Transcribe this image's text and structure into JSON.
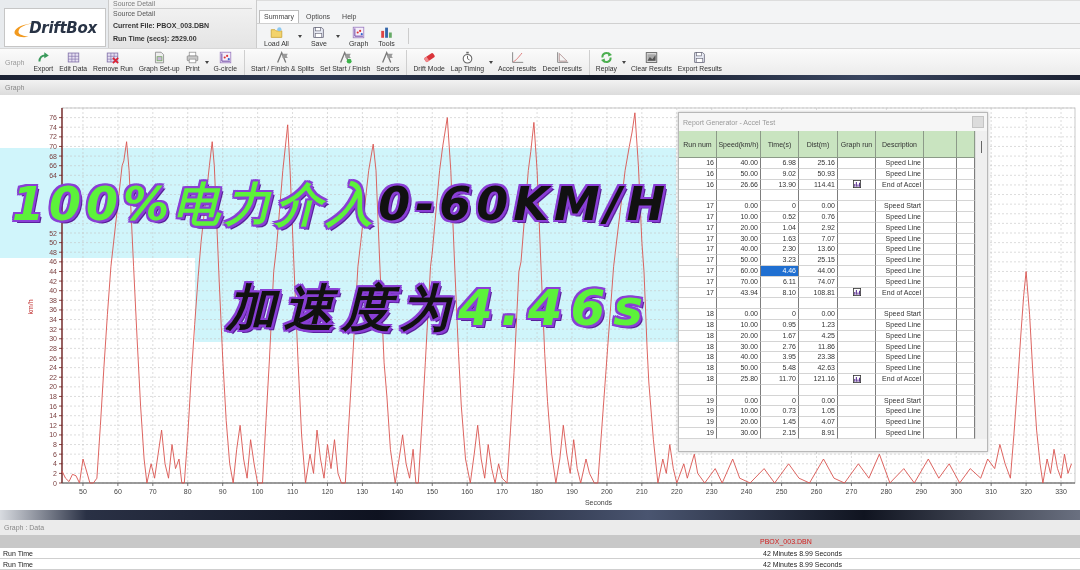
{
  "logo": "DriftBox",
  "source_panel": {
    "header": "Source Detail",
    "title": "Source Detail",
    "current_file": "Current File: PBOX_003.DBN",
    "run_time": "Run Time (secs): 2529.00"
  },
  "menu_tabs": [
    {
      "label": "Summary",
      "selected": true
    },
    {
      "label": "Options",
      "selected": false
    },
    {
      "label": "Help",
      "selected": false
    }
  ],
  "ribbon_buttons": [
    {
      "label": "Load All",
      "dropdown": true
    },
    {
      "label": "Save",
      "dropdown": true
    },
    {
      "label": "Graph",
      "dropdown": false
    },
    {
      "label": "Tools",
      "dropdown": false
    }
  ],
  "toolbar": {
    "label": "Graph",
    "groups": [
      {
        "items": [
          {
            "label": "Export",
            "dropdown": false
          },
          {
            "label": "Edit Data",
            "dropdown": false
          },
          {
            "label": "Remove Run",
            "dropdown": false
          },
          {
            "label": "Graph Set-up",
            "dropdown": false
          },
          {
            "label": "Print",
            "dropdown": true
          },
          {
            "label": "G-circle",
            "dropdown": false
          }
        ]
      },
      {
        "items": [
          {
            "label": "Start / Finish & Splits",
            "dropdown": false
          },
          {
            "label": "Set Start / Finish",
            "dropdown": false
          },
          {
            "label": "Sectors",
            "dropdown": false
          }
        ]
      },
      {
        "items": [
          {
            "label": "Drift Mode",
            "dropdown": false
          },
          {
            "label": "Lap Timing",
            "dropdown": true
          },
          {
            "label": "Accel results",
            "dropdown": false
          },
          {
            "label": "Decel results",
            "dropdown": false
          }
        ]
      },
      {
        "items": [
          {
            "label": "Replay",
            "dropdown": true
          },
          {
            "label": "Clear Results",
            "dropdown": false
          },
          {
            "label": "Export Results",
            "dropdown": false
          }
        ]
      }
    ]
  },
  "graph_panel": {
    "title": "Graph",
    "chart_data": {
      "type": "line",
      "xlabel": "Seconds",
      "ylabel": "km/h",
      "grid": true,
      "xlim": [
        44,
        334
      ],
      "ylim": [
        0,
        78
      ],
      "xticks": [
        50,
        60,
        70,
        80,
        90,
        100,
        110,
        120,
        130,
        140,
        150,
        160,
        170,
        180,
        190,
        200,
        210,
        220,
        230,
        240,
        250,
        260,
        270,
        280,
        290,
        300,
        310,
        320,
        330
      ],
      "yticks": [
        0,
        2,
        4,
        6,
        8,
        10,
        12,
        14,
        16,
        18,
        20,
        22,
        24,
        26,
        28,
        30,
        32,
        34,
        36,
        38,
        40,
        42,
        44,
        46,
        48,
        50,
        52,
        64,
        66,
        68,
        70,
        72,
        74,
        76
      ],
      "x": [
        44,
        45,
        46,
        47,
        48,
        49,
        50,
        51,
        52,
        53,
        54,
        55,
        56,
        57,
        58,
        61.2,
        61.7,
        62.5,
        63.2,
        64.5,
        65.5,
        66.5,
        67.5,
        68.3,
        69.5,
        70.5,
        71.5,
        72.5,
        73.5,
        74.5,
        75.5,
        76.5,
        77.5,
        78.3,
        79,
        80,
        81,
        82,
        83,
        83.8,
        86.2,
        87,
        87.6,
        89,
        90,
        91,
        92,
        93,
        94,
        95,
        96,
        97,
        98,
        99,
        100,
        101.4,
        102.4,
        103.4,
        104.6,
        105.4,
        107.2,
        108.6,
        109.3,
        110.3,
        111.6,
        112.6,
        113.7,
        115,
        116,
        117,
        118,
        119,
        120,
        121,
        122,
        123,
        124,
        125.1,
        126,
        127,
        128.7,
        129.5,
        131.8,
        133.1,
        133.9,
        134.9,
        136.2,
        137,
        138,
        139.4,
        140.5,
        141.5,
        142.5,
        143.5,
        144.5,
        145.3,
        146,
        147,
        148,
        149.5,
        150,
        152.1,
        153,
        154.3,
        155.3,
        156.3,
        157.5,
        158.3,
        159.5,
        160.9,
        162,
        163,
        164,
        165,
        166,
        167,
        168,
        169,
        170,
        171.4,
        172.4,
        173.4,
        174.8,
        175.4,
        177.5,
        178.2,
        179.1,
        180,
        181,
        182.2,
        183,
        184.2,
        185.4,
        186.5,
        187.5,
        188.5,
        189.5,
        190.5,
        191.5,
        192.5,
        194,
        195,
        196.4,
        197.4,
        198.4,
        199.4,
        200.2,
        201.9,
        202.4,
        205.2,
        206.4,
        207.2,
        208,
        209,
        210,
        210.6,
        211.5,
        212,
        213.3,
        214.6,
        216,
        217,
        218,
        219,
        220,
        222,
        223,
        225,
        226,
        228,
        231,
        233,
        236,
        238,
        241,
        245,
        248,
        252,
        255,
        258,
        262,
        265,
        268,
        272,
        275,
        278,
        281,
        285,
        288,
        292,
        295,
        298,
        301,
        304,
        307,
        309,
        311,
        312.5,
        314,
        315.5,
        316.5,
        317.5,
        318.5,
        319.3,
        320,
        321,
        322,
        323,
        324,
        324.8,
        326,
        327,
        328,
        329,
        330,
        331,
        332,
        333
      ],
      "series": [
        {
          "color": "#d9534f",
          "values": [
            2.5,
            1,
            0.3,
            1.8,
            1.5,
            0,
            5,
            2.5,
            0,
            0,
            1,
            12,
            24,
            35,
            45,
            66,
            67,
            71,
            65,
            45,
            30,
            16,
            5,
            0,
            4,
            1,
            6,
            11,
            4,
            1,
            8,
            3,
            5,
            0,
            0,
            10,
            22,
            33,
            43,
            50,
            66,
            71,
            66,
            42,
            26,
            13,
            4,
            0,
            7,
            12,
            5,
            1,
            9,
            4,
            0,
            0,
            13,
            26,
            44,
            49,
            65,
            74.5,
            65,
            47,
            25,
            10,
            0,
            6,
            2,
            11,
            5,
            1,
            8,
            3,
            9,
            2,
            0,
            0,
            11,
            23,
            45,
            50,
            65,
            70.5,
            65,
            47,
            25,
            18,
            7,
            0,
            5,
            10,
            4,
            1,
            7,
            0,
            0,
            12,
            25,
            45,
            48,
            65,
            70,
            76,
            65,
            47,
            27,
            16,
            5,
            0,
            6,
            12,
            5,
            1,
            8,
            3,
            0,
            4,
            1,
            0,
            11,
            23,
            44,
            46,
            65,
            69,
            75,
            65,
            47,
            27,
            17,
            6,
            0,
            5,
            12,
            6,
            2,
            9,
            3,
            0,
            5,
            2,
            0,
            0,
            10,
            20,
            28,
            45,
            48,
            65,
            70,
            73,
            77,
            66,
            50,
            44,
            28,
            21,
            9,
            0,
            5,
            2,
            8,
            3,
            0,
            4,
            1,
            6,
            2,
            0,
            3,
            0,
            5,
            1,
            0,
            3,
            0,
            4,
            1,
            0,
            5,
            1,
            0,
            4,
            1,
            6,
            0,
            3,
            0,
            5,
            1,
            4,
            0,
            3,
            1,
            5,
            3,
            8,
            4,
            1,
            10,
            20,
            31,
            39,
            44,
            35,
            22,
            11,
            4,
            0,
            5,
            2,
            7,
            3,
            1,
            6,
            2,
            4
          ]
        }
      ]
    }
  },
  "captions": [
    {
      "segments": [
        {
          "text": "100%电力介入",
          "highlight": true
        },
        {
          "text": "0-60KM/H",
          "highlight": false
        }
      ]
    },
    {
      "segments": [
        {
          "text": "加速度为",
          "highlight": false
        },
        {
          "text": "4.46s",
          "highlight": true
        }
      ]
    }
  ],
  "report": {
    "title": "Report Generator - Accel Test",
    "columns": [
      "Run num",
      "Speed(km/h)",
      "Time(s)",
      "Dist(m)",
      "Graph run",
      "Description"
    ],
    "rows": [
      {
        "kind": "data",
        "run": "16",
        "speed": "40.00",
        "time": "6.98",
        "dist": "25.16",
        "graph_icon": false,
        "description": "Speed Line",
        "time_selected": false
      },
      {
        "kind": "data",
        "run": "16",
        "speed": "50.00",
        "time": "9.02",
        "dist": "50.93",
        "graph_icon": false,
        "description": "Speed Line",
        "time_selected": false
      },
      {
        "kind": "data",
        "run": "16",
        "speed": "26.66",
        "time": "13.90",
        "dist": "114.41",
        "graph_icon": true,
        "description": "End of Accel",
        "time_selected": false
      },
      {
        "kind": "blank"
      },
      {
        "kind": "data",
        "run": "17",
        "speed": "0.00",
        "time": "0",
        "dist": "0.00",
        "graph_icon": false,
        "description": "Speed Start",
        "time_selected": false
      },
      {
        "kind": "data",
        "run": "17",
        "speed": "10.00",
        "time": "0.52",
        "dist": "0.76",
        "graph_icon": false,
        "description": "Speed Line",
        "time_selected": false
      },
      {
        "kind": "data",
        "run": "17",
        "speed": "20.00",
        "time": "1.04",
        "dist": "2.92",
        "graph_icon": false,
        "description": "Speed Line",
        "time_selected": false
      },
      {
        "kind": "data",
        "run": "17",
        "speed": "30.00",
        "time": "1.63",
        "dist": "7.07",
        "graph_icon": false,
        "description": "Speed Line",
        "time_selected": false
      },
      {
        "kind": "data",
        "run": "17",
        "speed": "40.00",
        "time": "2.30",
        "dist": "13.60",
        "graph_icon": false,
        "description": "Speed Line",
        "time_selected": false
      },
      {
        "kind": "data",
        "run": "17",
        "speed": "50.00",
        "time": "3.23",
        "dist": "25.15",
        "graph_icon": false,
        "description": "Speed Line",
        "time_selected": false
      },
      {
        "kind": "data",
        "run": "17",
        "speed": "60.00",
        "time": "4.46",
        "dist": "44.00",
        "graph_icon": false,
        "description": "Speed Line",
        "time_selected": true
      },
      {
        "kind": "data",
        "run": "17",
        "speed": "70.00",
        "time": "6.11",
        "dist": "74.07",
        "graph_icon": false,
        "description": "Speed Line",
        "time_selected": false
      },
      {
        "kind": "data",
        "run": "17",
        "speed": "43.94",
        "time": "8.10",
        "dist": "108.81",
        "graph_icon": true,
        "description": "End of Accel",
        "time_selected": false
      },
      {
        "kind": "blank"
      },
      {
        "kind": "data",
        "run": "18",
        "speed": "0.00",
        "time": "0",
        "dist": "0.00",
        "graph_icon": false,
        "description": "Speed Start",
        "time_selected": false
      },
      {
        "kind": "data",
        "run": "18",
        "speed": "10.00",
        "time": "0.95",
        "dist": "1.23",
        "graph_icon": false,
        "description": "Speed Line",
        "time_selected": false
      },
      {
        "kind": "data",
        "run": "18",
        "speed": "20.00",
        "time": "1.67",
        "dist": "4.25",
        "graph_icon": false,
        "description": "Speed Line",
        "time_selected": false
      },
      {
        "kind": "data",
        "run": "18",
        "speed": "30.00",
        "time": "2.76",
        "dist": "11.86",
        "graph_icon": false,
        "description": "Speed Line",
        "time_selected": false
      },
      {
        "kind": "data",
        "run": "18",
        "speed": "40.00",
        "time": "3.95",
        "dist": "23.38",
        "graph_icon": false,
        "description": "Speed Line",
        "time_selected": false
      },
      {
        "kind": "data",
        "run": "18",
        "speed": "50.00",
        "time": "5.48",
        "dist": "42.63",
        "graph_icon": false,
        "description": "Speed Line",
        "time_selected": false
      },
      {
        "kind": "data",
        "run": "18",
        "speed": "25.80",
        "time": "11.70",
        "dist": "121.16",
        "graph_icon": true,
        "description": "End of Accel",
        "time_selected": false
      },
      {
        "kind": "blank"
      },
      {
        "kind": "data",
        "run": "19",
        "speed": "0.00",
        "time": "0",
        "dist": "0.00",
        "graph_icon": false,
        "description": "Speed Start",
        "time_selected": false
      },
      {
        "kind": "data",
        "run": "19",
        "speed": "10.00",
        "time": "0.73",
        "dist": "1.05",
        "graph_icon": false,
        "description": "Speed Line",
        "time_selected": false
      },
      {
        "kind": "data",
        "run": "19",
        "speed": "20.00",
        "time": "1.45",
        "dist": "4.07",
        "graph_icon": false,
        "description": "Speed Line",
        "time_selected": false
      },
      {
        "kind": "data",
        "run": "19",
        "speed": "30.00",
        "time": "2.15",
        "dist": "8.91",
        "graph_icon": false,
        "description": "Speed Line",
        "time_selected": false
      }
    ]
  },
  "data_panel": {
    "title": "Graph : Data",
    "file": "PBOX_003.DBN",
    "rows": [
      {
        "label": "Run Time",
        "value": "42 Minutes 8.99 Seconds"
      },
      {
        "label": "Run Time",
        "value": "42 Minutes 8.99 Seconds"
      }
    ]
  }
}
